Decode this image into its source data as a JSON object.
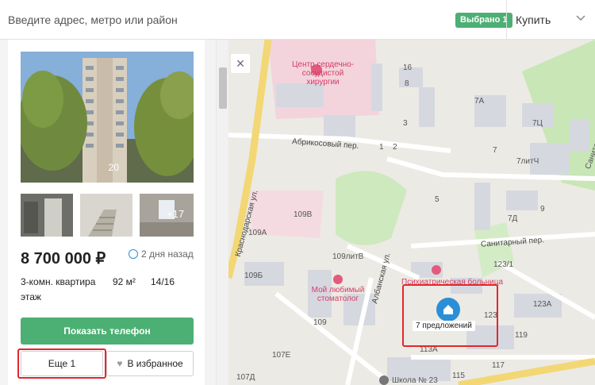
{
  "search": {
    "placeholder": "Введите адрес, метро или район"
  },
  "header": {
    "selected_badge": "Выбрано 1",
    "deal_type": "Купить"
  },
  "listing": {
    "photo_count": "20",
    "thumb_more": "+17",
    "price": "8 700 000 ₽",
    "time_ago": "2 дня назад",
    "rooms": "3-комн. квартира",
    "area": "92 м²",
    "floor": "14/16",
    "floor_word": "этаж",
    "phone_button": "Показать телефон",
    "more_button": "Еще 1",
    "favorite_button": "В избранное"
  },
  "map": {
    "labels": {
      "hospital_cardio": "Центр сердечно-\nсосудистой\nхирургии",
      "street_abrikosovy": "Абрикосовый пер.",
      "street_krasnodarskaya": "Краснодарская ул.",
      "street_sanitarny": "Санитарный пер.",
      "street_albanskaya": "Албанская ул.",
      "dentist": "Мой любимый\nстоматолог",
      "psych_hospital": "Психиатрическая\nбольница",
      "school": "Школа № 23",
      "n16": "16",
      "n8": "8",
      "n3": "3",
      "n2": "2",
      "n1": "1",
      "n7a": "7А",
      "n7ts": "7Ц",
      "n7": "7",
      "n7litch": "7литЧ",
      "n5": "5",
      "n7d": "7Д",
      "n9": "9",
      "n109v": "109В",
      "n109a": "109А",
      "n109litv": "109литВ",
      "n109b": "109Б",
      "n109": "109",
      "n123_1": "123/1",
      "n123a": "123А",
      "n123": "123",
      "n119": "119",
      "n113a": "113А",
      "n117": "117",
      "n115": "115",
      "n107e": "107Е",
      "n107d": "107Д",
      "sanitary_lane": "Санитарный"
    },
    "cluster_label": "7 предложений"
  },
  "colors": {
    "accent_green": "#4caf73",
    "highlight_red": "#e5262c",
    "map_blue": "#2b8fd8"
  }
}
